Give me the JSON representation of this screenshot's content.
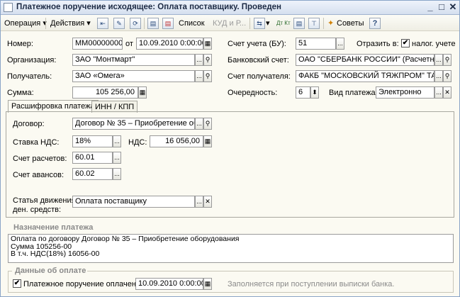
{
  "window": {
    "title": "Платежное поручение исходящее: Оплата поставщику. Проведен",
    "minimize": "_",
    "maximize": "□",
    "close": "✕"
  },
  "toolbar": {
    "operation": "Операция ▾",
    "actions": "Действия ▾",
    "list": "Список",
    "kud": "КУД и Р...",
    "dt_kt": "Дт Кт",
    "advice": "Советы",
    "help": "?"
  },
  "form": {
    "number_label": "Номер:",
    "number_value": "ММ000000001",
    "from_label": "от",
    "date_value": "10.09.2010 0:00:00",
    "org_label": "Организация:",
    "org_value": "ЗАО \"Монтмарт\"",
    "recipient_label": "Получатель:",
    "recipient_value": "ЗАО «Омега»",
    "sum_label": "Сумма:",
    "sum_value": "105 256,00",
    "account_bu_label": "Счет учета (БУ):",
    "account_bu_value": "51",
    "reflect_label": "Отразить в:",
    "reflect_check": "✔",
    "reflect_text": "налог. учете",
    "bank_account_label": "Банковский счет:",
    "bank_account_value": "ОАО \"СБЕРБАНК РОССИИ\" (Расчетный)",
    "recipient_account_label": "Счет получателя:",
    "recipient_account_value": "ФАКБ \"МОСКОВСКИЙ ТЯЖПРОМ\" ТАГА",
    "priority_label": "Очередность:",
    "priority_value": "6",
    "pay_type_label": "Вид платежа:",
    "pay_type_value": "Электронно"
  },
  "tabs": [
    {
      "label": "Расшифровка платежа"
    },
    {
      "label": "ИНН / КПП"
    }
  ],
  "breakdown": {
    "contract_label": "Договор:",
    "contract_value": "Договор № 35 – Приобретение оборуд",
    "vat_rate_label": "Ставка НДС:",
    "vat_rate_value": "18%",
    "vat_label": "НДС:",
    "vat_value": "16 056,00",
    "settle_label": "Счет расчетов:",
    "settle_value": "60.01",
    "advance_label": "Счет авансов:",
    "advance_value": "60.02",
    "cashflow_label_1": "Статья движения",
    "cashflow_label_2": "ден. средств:",
    "cashflow_value": "Оплата поставщику"
  },
  "purpose": {
    "title": "Назначение платежа",
    "line1": "Оплата по договору Договор № 35 – Приобретение оборудования",
    "line2": "Сумма 105256-00",
    "line3": "В т.ч. НДС(18%) 16056-00"
  },
  "payment": {
    "title": "Данные об оплате",
    "paid_check": "✔",
    "paid_label": "Платежное поручение оплачено:",
    "paid_date": "10.09.2010 0:00:00",
    "hint": "Заполняется при поступлении выписки банка."
  },
  "icons": {
    "ellipsis": "...",
    "search": "⚲",
    "clear": "✕",
    "calendar": "▦",
    "calculator": "▦",
    "spin": "⬍"
  }
}
